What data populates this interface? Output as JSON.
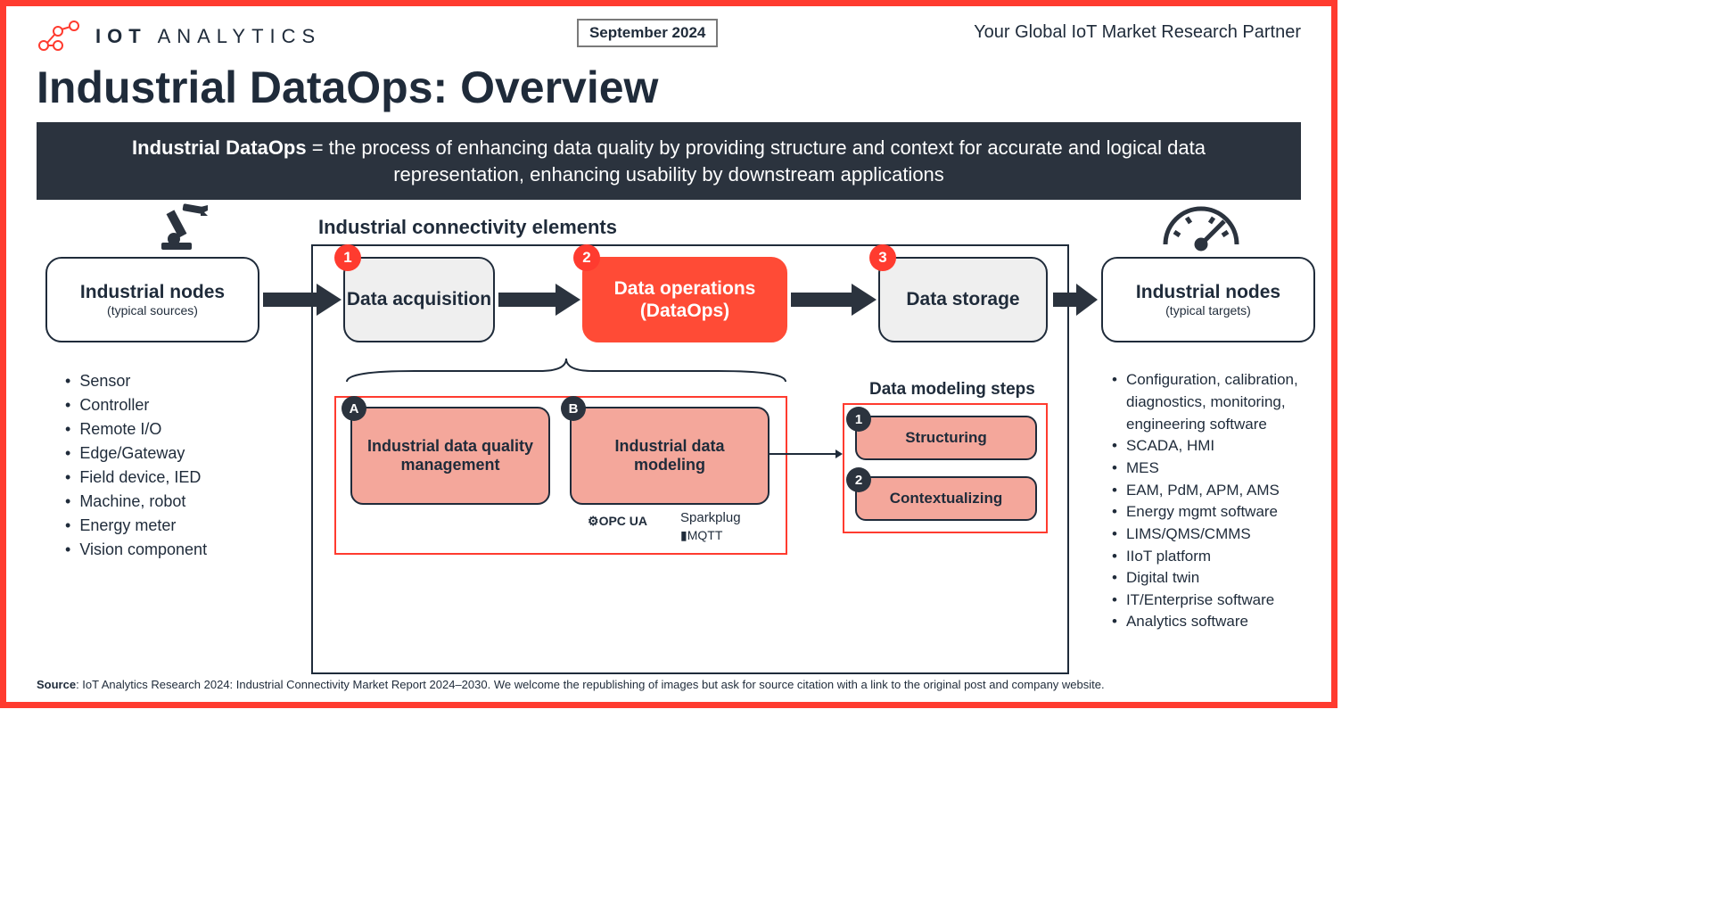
{
  "header": {
    "logo_text_bold": "IOT",
    "logo_text_light": " ANALYTICS",
    "date": "September 2024",
    "tagline": "Your Global IoT Market Research Partner"
  },
  "title": "Industrial DataOps: Overview",
  "definition_bold": "Industrial DataOps",
  "definition_rest": " = the process of enhancing data quality by providing structure and context for accurate and logical data representation, enhancing usability by downstream applications",
  "connectivity_label": "Industrial connectivity elements",
  "sources": {
    "title": "Industrial nodes",
    "sub": "(typical sources)",
    "items": [
      "Sensor",
      "Controller",
      "Remote I/O",
      "Edge/Gateway",
      "Field device, IED",
      "Machine, robot",
      "Energy meter",
      "Vision component"
    ]
  },
  "steps": {
    "s1": "Data acquisition",
    "s2a": "Data operations",
    "s2b": "(DataOps)",
    "s3": "Data storage"
  },
  "targets": {
    "title": "Industrial nodes",
    "sub": "(typical targets)",
    "items": [
      "Configuration, calibration, diagnostics, monitoring, engineering software",
      "SCADA, HMI",
      "MES",
      "EAM, PdM, APM, AMS",
      "Energy mgmt software",
      "LIMS/QMS/CMMS",
      "IIoT platform",
      "Digital twin",
      "IT/Enterprise software",
      "Analytics software"
    ]
  },
  "sub": {
    "a": "Industrial data quality management",
    "b": "Industrial data modeling",
    "protocols": {
      "opcua": "OPC UA",
      "sparkplug": "Sparkplug",
      "mqtt": "MQTT"
    }
  },
  "modeling": {
    "label": "Data modeling steps",
    "s1": "Structuring",
    "s2": "Contextualizing"
  },
  "source_bold": "Source",
  "source_rest": ": IoT Analytics Research 2024: Industrial Connectivity Market Report 2024–2030. We welcome the republishing of images but ask for source citation with a link to the original post and company website."
}
